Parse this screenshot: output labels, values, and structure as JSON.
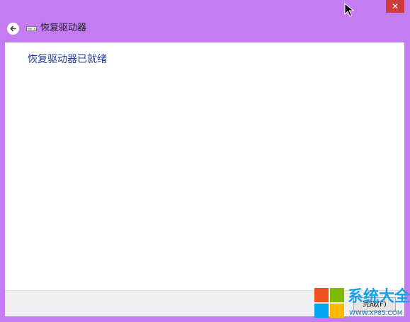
{
  "window": {
    "title": "恢复驱动器",
    "close_glyph": "✕",
    "background_color": "#c47cf3"
  },
  "content": {
    "heading": "恢复驱动器已就绪"
  },
  "footer": {
    "finish_label": "完成(F)"
  },
  "watermark": {
    "brand": "系统大全",
    "url": "WWW.XP85.COM",
    "colors": [
      "#f25022",
      "#7fba00",
      "#00a4ef",
      "#ffb900"
    ]
  },
  "icons": {
    "back": "back-arrow-icon",
    "drive": "drive-icon",
    "close": "close-icon",
    "cursor": "mouse-cursor-icon"
  }
}
